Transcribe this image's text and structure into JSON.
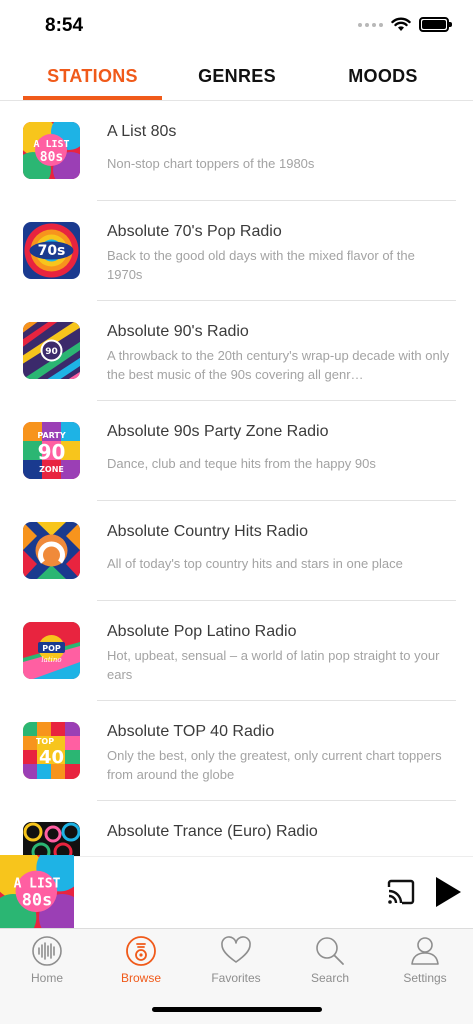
{
  "status": {
    "time": "8:54"
  },
  "tabs": [
    {
      "label": "STATIONS",
      "active": true
    },
    {
      "label": "GENRES",
      "active": false
    },
    {
      "label": "MOODS",
      "active": false
    }
  ],
  "stations": [
    {
      "title": "A List 80s",
      "desc": "Non-stop chart toppers of the 1980s",
      "art": "alist-80s-art"
    },
    {
      "title": "Absolute 70's Pop Radio",
      "desc": "Back to the good old days with the mixed flavor of the 1970s",
      "art": "70s-art"
    },
    {
      "title": "Absolute 90's Radio",
      "desc": "A throwback to the 20th century's wrap-up decade with only the best music of the 90s covering all genr…",
      "art": "90s-art"
    },
    {
      "title": "Absolute 90s Party Zone Radio",
      "desc": "Dance, club and teque hits from the happy 90s",
      "art": "party-90s-art"
    },
    {
      "title": "Absolute Country Hits Radio",
      "desc": "All of today's top country hits and stars in one place",
      "art": "country-art"
    },
    {
      "title": "Absolute Pop Latino Radio",
      "desc": "Hot, upbeat, sensual – a world of latin pop straight to your ears",
      "art": "pop-latino-art"
    },
    {
      "title": "Absolute TOP 40 Radio",
      "desc": "Only the best, only the greatest, only current chart toppers from around the globe",
      "art": "top40-art"
    },
    {
      "title": "Absolute Trance (Euro) Radio",
      "desc": "",
      "art": "trance-art"
    }
  ],
  "art_text": {
    "alist": "A LIST",
    "eighties": "80s",
    "seventies": "70s",
    "nineties": "90",
    "party": "PARTY",
    "party_num": "90",
    "zone": "ZONE",
    "pop": "POP",
    "latino": "latino",
    "top": "TOP",
    "forty": "40"
  },
  "player": {
    "art": "alist-80s-art",
    "cast_icon": "cast-icon",
    "play_icon": "play-icon"
  },
  "tabbar": [
    {
      "label": "Home",
      "icon": "waveform-icon",
      "active": false
    },
    {
      "label": "Browse",
      "icon": "browse-icon",
      "active": true
    },
    {
      "label": "Favorites",
      "icon": "heart-icon",
      "active": false
    },
    {
      "label": "Search",
      "icon": "search-icon",
      "active": false
    },
    {
      "label": "Settings",
      "icon": "person-icon",
      "active": false
    }
  ],
  "colors": {
    "accent": "#f05a1a",
    "title_text": "#3b3b3b",
    "subtitle_text": "#a3a3a3",
    "tab_inactive": "#8e8e8e"
  }
}
